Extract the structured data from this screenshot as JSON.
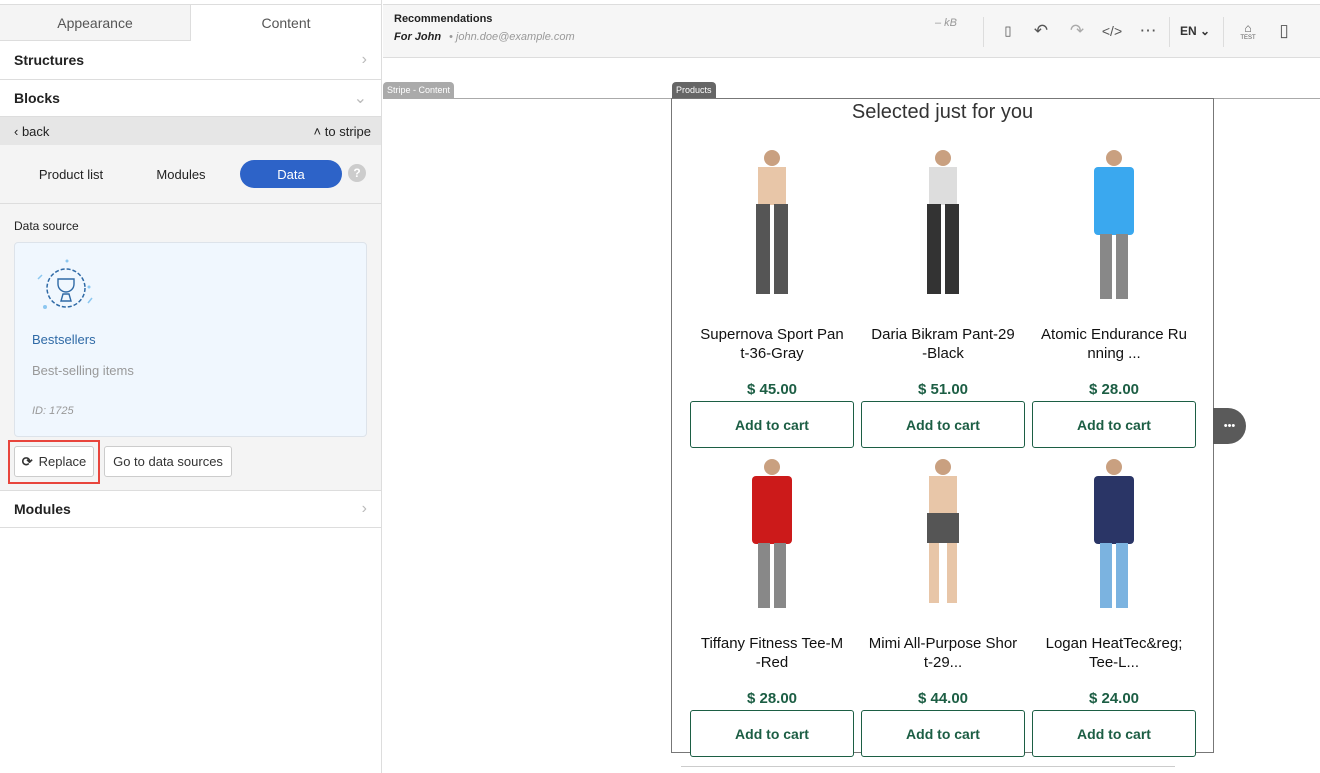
{
  "left_panel": {
    "tabs": [
      {
        "label": "Appearance",
        "active": false
      },
      {
        "label": "Content",
        "active": true
      }
    ],
    "structures": "Structures",
    "blocks": "Blocks",
    "back": "back",
    "to_stripe": "to stripe",
    "subtabs": [
      {
        "label": "Product list"
      },
      {
        "label": "Modules"
      },
      {
        "label": "Data",
        "active": true
      }
    ],
    "help": "?",
    "data_source_label": "Data source",
    "card": {
      "title": "Bestsellers",
      "description": "Best-selling items",
      "id": "ID: 1725",
      "icon": "trophy-badge-icon"
    },
    "replace": "Replace",
    "go_to_sources": "Go to data sources",
    "modules": "Modules"
  },
  "header": {
    "title": "Recommendations",
    "for": "For John",
    "email": "john.doe@example.com",
    "size": "– kB",
    "language": "EN",
    "test": "TEST"
  },
  "canvas": {
    "stripe_label": "Stripe - Content",
    "products_label": "Products",
    "heading": "Selected just for you",
    "more": "•••",
    "products": [
      {
        "name": "Supernova Sport Pant-36-Gray",
        "display": [
          "Supernova Sport Pan",
          "t-36-Gray"
        ],
        "price": "$ 45.00",
        "cta": "Add to cart",
        "color": "#555555"
      },
      {
        "name": "Daria Bikram Pant-29-Black",
        "display": [
          "Daria Bikram Pant-29",
          "-Black"
        ],
        "price": "$ 51.00",
        "cta": "Add to cart",
        "color": "#333333"
      },
      {
        "name": "Atomic Endurance Running ...",
        "display": [
          "Atomic Endurance Ru",
          "nning ..."
        ],
        "price": "$ 28.00",
        "cta": "Add to cart",
        "color": "#3aa8ef"
      },
      {
        "name": "Tiffany Fitness Tee-M-Red",
        "display": [
          "Tiffany Fitness Tee-M",
          "-Red"
        ],
        "price": "$ 28.00",
        "cta": "Add to cart",
        "color": "#cc1a1a"
      },
      {
        "name": "Mimi All-Purpose Short-29...",
        "display": [
          "Mimi All-Purpose Sho",
          "rt-29..."
        ],
        "price": "$ 44.00",
        "cta": "Add to cart",
        "color": "#555555"
      },
      {
        "name": "Logan HeatTec&reg; Tee-L...",
        "display": [
          "Logan HeatTec&reg;",
          "Tee-L..."
        ],
        "price": "$ 24.00",
        "cta": "Add to cart",
        "color": "#2a3566"
      }
    ]
  },
  "colors": {
    "accent": "#2d63c8",
    "price": "#1c5e44",
    "highlight": "#e8453c"
  }
}
